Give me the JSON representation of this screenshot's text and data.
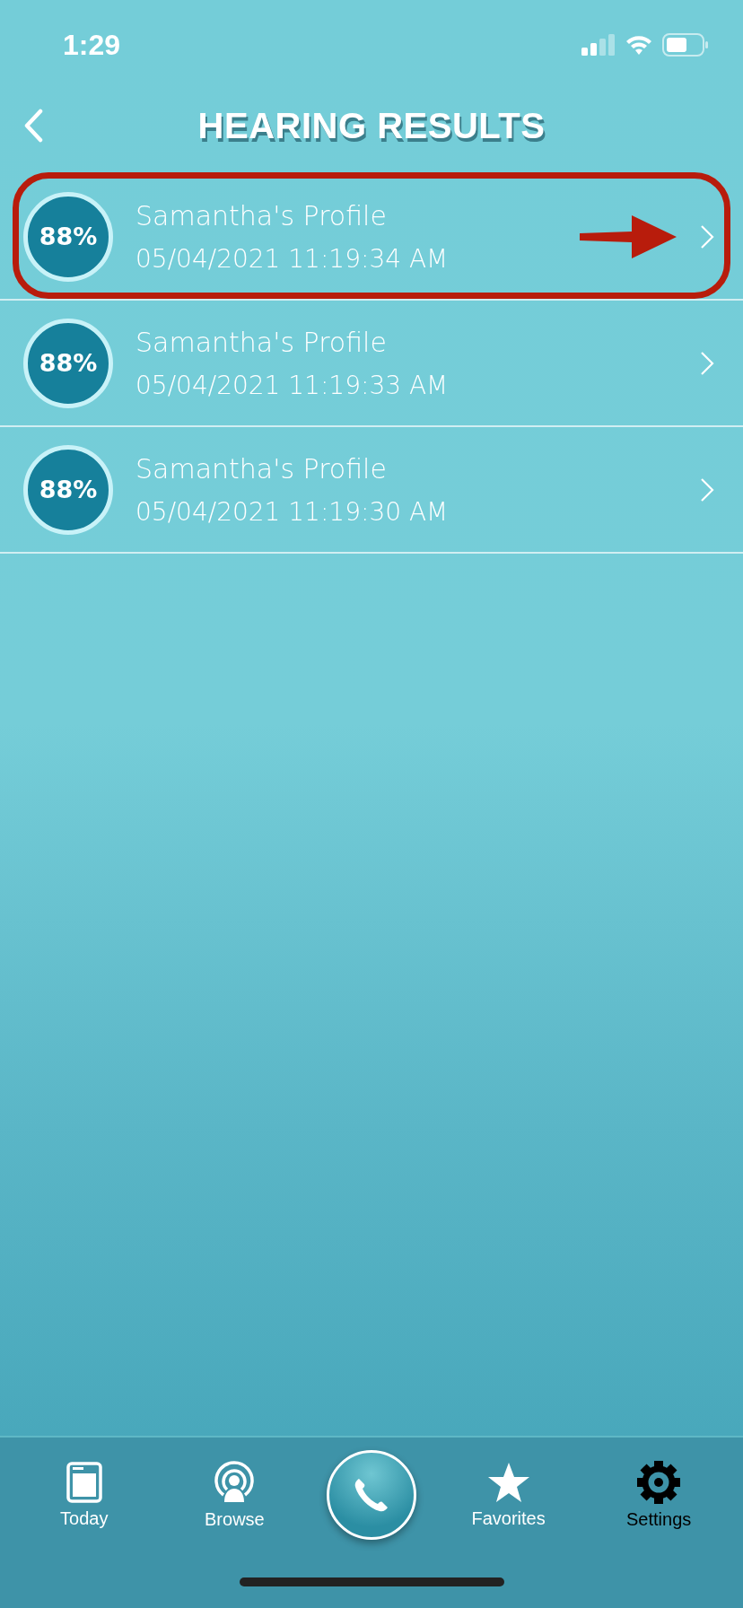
{
  "status_bar": {
    "time": "1:29"
  },
  "nav": {
    "title": "HEARING RESULTS"
  },
  "results": [
    {
      "score": "88%",
      "name": "Samantha's Profile",
      "date": "05/04/2021 11:19:34 AM",
      "highlighted": true
    },
    {
      "score": "88%",
      "name": "Samantha's Profile",
      "date": "05/04/2021 11:19:33 AM",
      "highlighted": false
    },
    {
      "score": "88%",
      "name": "Samantha's Profile",
      "date": "05/04/2021 11:19:30 AM",
      "highlighted": false
    }
  ],
  "tab_bar": [
    {
      "kind": "today",
      "label": "Today",
      "selected": false
    },
    {
      "kind": "browse",
      "label": "Browse",
      "selected": false
    },
    {
      "kind": "call"
    },
    {
      "kind": "favorites",
      "label": "Favorites",
      "selected": false
    },
    {
      "kind": "settings",
      "label": "Settings",
      "selected": true
    }
  ]
}
